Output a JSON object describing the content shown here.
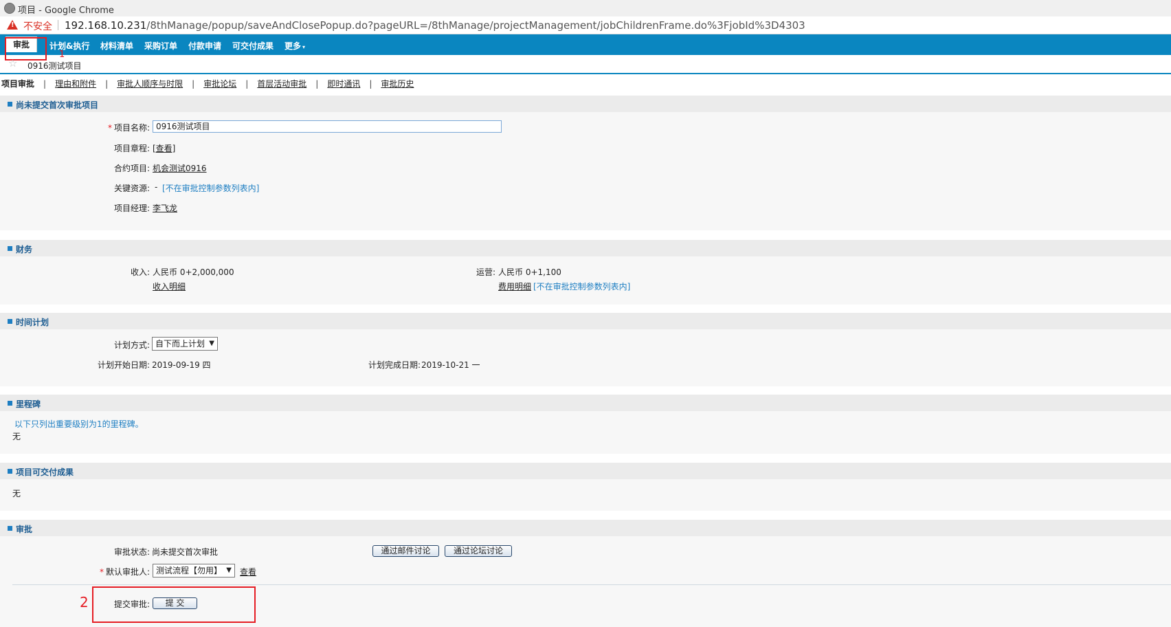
{
  "window": {
    "title": "项目 - Google Chrome"
  },
  "address": {
    "warning": "不安全",
    "host": "192.168.10.231",
    "path": "/8thManage/popup/saveAndClosePopup.do?pageURL=/8thManage/projectManagement/jobChildrenFrame.do%3FjobId%3D4303"
  },
  "menu": {
    "items": [
      {
        "label": "审批"
      },
      {
        "label": "计划&执行"
      },
      {
        "label": "材料清单"
      },
      {
        "label": "采购订单"
      },
      {
        "label": "付款申请"
      },
      {
        "label": "可交付成果"
      },
      {
        "label": "更多"
      }
    ]
  },
  "annotations": {
    "one": "1",
    "two": "2"
  },
  "project": {
    "name": "0916测试项目"
  },
  "tabs": [
    {
      "label": "项目审批"
    },
    {
      "label": "理由和附件"
    },
    {
      "label": "审批人顺序与时限"
    },
    {
      "label": "审批论坛"
    },
    {
      "label": "首层活动审批"
    },
    {
      "label": "即时通讯"
    },
    {
      "label": "审批历史"
    }
  ],
  "sections": {
    "basic": {
      "title": "尚未提交首次审批项目",
      "name_label": "项目名称:",
      "name_value": "0916测试项目",
      "charter_label": "项目章程:",
      "charter_link": "[查看]",
      "contract_label": "合约项目:",
      "contract_link": "机会测试0916",
      "resource_label": "关键资源:",
      "resource_value": "-",
      "resource_note": "[不在审批控制参数列表内]",
      "manager_label": "项目经理:",
      "manager_link": "李飞龙"
    },
    "finance": {
      "title": "财务",
      "income_label": "收入:",
      "income_value": "人民币 0+2,000,000",
      "income_link": "收入明细",
      "ops_label": "运营:",
      "ops_value": "人民币 0+1,100",
      "cost_link": "费用明细",
      "cost_note": "[不在审批控制参数列表内]"
    },
    "schedule": {
      "title": "时间计划",
      "method_label": "计划方式:",
      "method_value": "自下而上计划",
      "start_label": "计划开始日期:",
      "start_value": "2019-09-19 四",
      "end_label": "计划完成日期:",
      "end_value": "2019-10-21 一"
    },
    "milestone": {
      "title": "里程碑",
      "note": "以下只列出重要级别为1的里程碑。",
      "value": "无"
    },
    "deliverables": {
      "title": "项目可交付成果",
      "value": "无"
    },
    "approval": {
      "title": "审批",
      "status_label": "审批状态:",
      "status_value": "尚未提交首次审批",
      "email_button": "通过邮件讨论",
      "forum_button": "通过论坛讨论",
      "approver_label": "默认审批人:",
      "approver_value": "测试流程【勿用】",
      "view_link": "查看",
      "submit_label": "提交审批:",
      "submit_button": "提 交"
    }
  },
  "colors": {
    "menu_bg": "#0a86c0",
    "section_title": "#1d5d92",
    "link_blue": "#1d7ec2",
    "highlight_red": "#e51c23"
  }
}
